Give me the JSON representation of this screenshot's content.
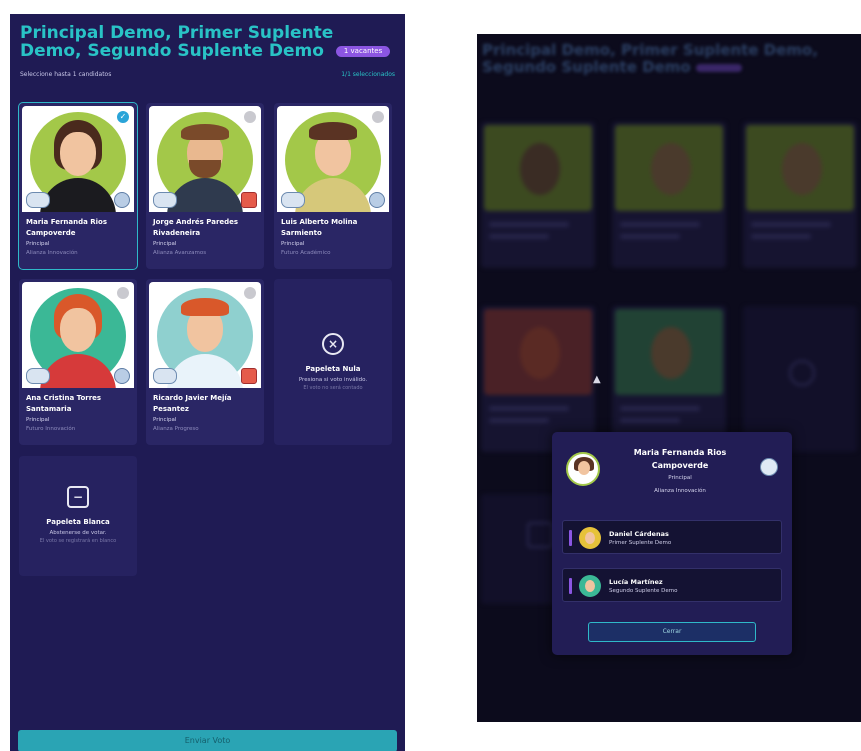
{
  "ballot": {
    "title": "Principal Demo, Primer Suplente Demo, Segundo Suplente Demo",
    "vacancies_badge": "1 vacantes",
    "instruction": "Seleccione hasta 1 candidatos",
    "selected_count": "1/1 seleccionados"
  },
  "candidates": [
    {
      "name": "Maria Fernanda Rios Campoverde",
      "role": "Principal",
      "party": "Alianza Innovación",
      "selected": true
    },
    {
      "name": "Jorge Andrés Paredes Rivadeneira",
      "role": "Principal",
      "party": "Alianza Avanzamos",
      "selected": false
    },
    {
      "name": "Luis Alberto Molina Sarmiento",
      "role": "Principal",
      "party": "Futuro Académico",
      "selected": false
    },
    {
      "name": "Ana Cristina Torres Santamaria",
      "role": "Principal",
      "party": "Futuro Innovación",
      "selected": false
    },
    {
      "name": "Ricardo Javier Mejía Pesantez",
      "role": "Principal",
      "party": "Alianza Progreso",
      "selected": false
    }
  ],
  "null_ballot": {
    "icon": "x-circle-icon",
    "title": "Papeleta Nula",
    "description": "Presiona si voto inválido.",
    "note": "El voto no será contado"
  },
  "blank_ballot": {
    "icon": "minus-square-icon",
    "title": "Papeleta Blanca",
    "description": "Abstenerse de votar.",
    "note": "El voto se registrará en blanco"
  },
  "submit_label": "Enviar Voto",
  "modal": {
    "name": "Maria Fernanda Rios Campoverde",
    "role": "Principal",
    "party": "Alianza Innovación",
    "substitutes": [
      {
        "name": "Daniel Cárdenas",
        "role": "Primer Suplente Demo"
      },
      {
        "name": "Lucía Martínez",
        "role": "Segundo Suplente Demo"
      }
    ],
    "close_label": "Cerrar"
  },
  "colors": {
    "panel_bg": "#1f1b54",
    "accent_teal": "#29c3c6",
    "badge_purple": "#8b56e2",
    "halo_green": "#a3c849",
    "halo_teal": "#3bb896"
  }
}
